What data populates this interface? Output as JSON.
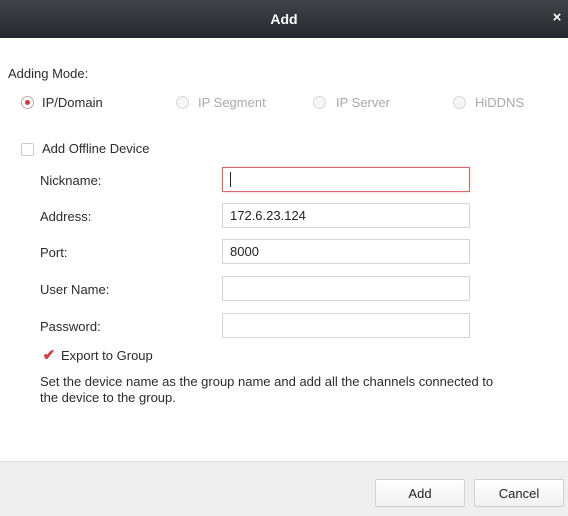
{
  "window": {
    "title": "Add",
    "close_glyph": "×"
  },
  "adding_mode": {
    "label": "Adding Mode:",
    "options": [
      {
        "label": "IP/Domain",
        "selected": true,
        "enabled": true
      },
      {
        "label": "IP Segment",
        "selected": false,
        "enabled": false
      },
      {
        "label": "IP Server",
        "selected": false,
        "enabled": false
      },
      {
        "label": "HiDDNS",
        "selected": false,
        "enabled": false
      }
    ]
  },
  "offline_device": {
    "label": "Add Offline Device",
    "checked": false
  },
  "form": {
    "nickname": {
      "label": "Nickname:",
      "value": ""
    },
    "address": {
      "label": "Address:",
      "value": "172.6.23.124"
    },
    "port": {
      "label": "Port:",
      "value": "8000"
    },
    "username": {
      "label": "User Name:",
      "value": ""
    },
    "password": {
      "label": "Password:",
      "value": ""
    }
  },
  "export_group": {
    "label": "Export to Group",
    "checked": true,
    "check_glyph": "✔",
    "description": "Set the device name as the group name and add all the channels connected to the device to the group."
  },
  "footer": {
    "add_label": "Add",
    "cancel_label": "Cancel"
  },
  "colors": {
    "accent": "#d23c3c",
    "titlebar": "#2f3237",
    "footer": "#efefef"
  },
  "icons": {
    "close": "close-icon",
    "check": "checkmark-icon"
  }
}
